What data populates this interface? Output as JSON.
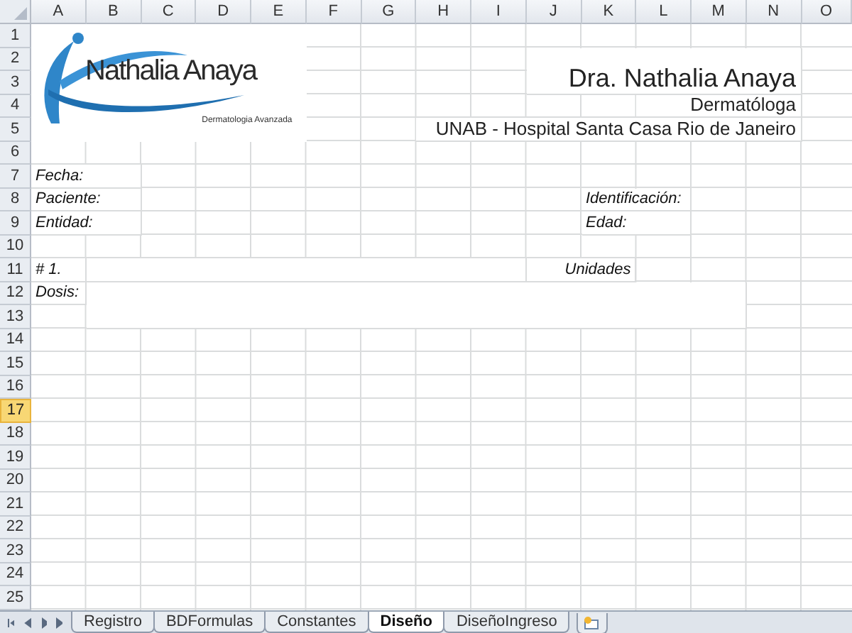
{
  "logo": {
    "name": "Nathalia Anaya",
    "tagline": "Dermatologia Avanzada"
  },
  "letterhead": {
    "doctor": "Dra. Nathalia Anaya",
    "specialty": "Dermatóloga",
    "institution": "UNAB - Hospital Santa Casa Rio de Janeiro"
  },
  "patient_labels": [
    "Fecha:",
    "Paciente:",
    "Entidad:"
  ],
  "right_labels": [
    "Identificación:",
    "Edad:"
  ],
  "prescription": {
    "item": "# 1.",
    "units": "Unidades",
    "dose": "Dosis:"
  },
  "columns": [
    "A",
    "B",
    "C",
    "D",
    "E",
    "F",
    "G",
    "H",
    "I",
    "J",
    "K",
    "L",
    "M",
    "N",
    "O"
  ],
  "rows": [
    {
      "label": "1",
      "selected": false
    },
    {
      "label": "2",
      "selected": false
    },
    {
      "label": "3",
      "selected": false
    },
    {
      "label": "4",
      "selected": false
    },
    {
      "label": "5",
      "selected": false
    },
    {
      "label": "6",
      "selected": false
    },
    {
      "label": "7",
      "selected": false
    },
    {
      "label": "8",
      "selected": false
    },
    {
      "label": "9",
      "selected": false
    },
    {
      "label": "10",
      "selected": false
    },
    {
      "label": "11",
      "selected": false
    },
    {
      "label": "12",
      "selected": false
    },
    {
      "label": "13",
      "selected": false
    },
    {
      "label": "14",
      "selected": false
    },
    {
      "label": "15",
      "selected": false
    },
    {
      "label": "16",
      "selected": false
    },
    {
      "label": "17",
      "selected": true
    },
    {
      "label": "18",
      "selected": false
    },
    {
      "label": "19",
      "selected": false
    },
    {
      "label": "20",
      "selected": false
    },
    {
      "label": "21",
      "selected": false
    },
    {
      "label": "22",
      "selected": false
    },
    {
      "label": "23",
      "selected": false
    },
    {
      "label": "24",
      "selected": false
    },
    {
      "label": "25",
      "selected": false
    }
  ],
  "sheet_tabs": [
    {
      "label": "Registro",
      "selected": false
    },
    {
      "label": "BDFormulas",
      "selected": false
    },
    {
      "label": "Constantes",
      "selected": false
    },
    {
      "label": "Diseño",
      "selected": true
    },
    {
      "label": "DiseñoIngreso",
      "selected": false
    }
  ]
}
